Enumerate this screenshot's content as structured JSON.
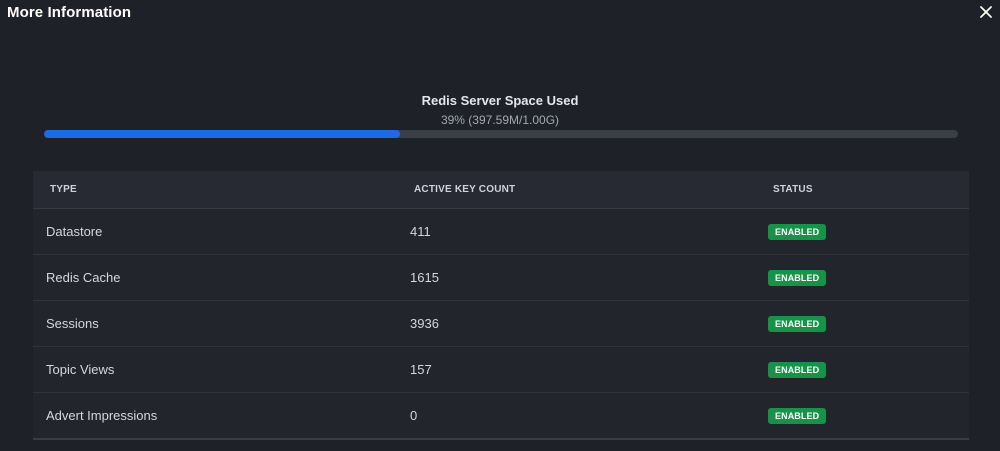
{
  "dialog": {
    "title": "More Information",
    "close_icon": "close-icon"
  },
  "usage": {
    "title": "Redis Server Space Used",
    "summary": "39% (397.59M/1.00G)",
    "percent": 39,
    "accent_color": "#1d6be2"
  },
  "table": {
    "headers": {
      "type": "TYPE",
      "count": "ACTIVE KEY COUNT",
      "status": "STATUS"
    },
    "rows": [
      {
        "type": "Datastore",
        "count": "411",
        "status": "ENABLED"
      },
      {
        "type": "Redis Cache",
        "count": "1615",
        "status": "ENABLED"
      },
      {
        "type": "Sessions",
        "count": "3936",
        "status": "ENABLED"
      },
      {
        "type": "Topic Views",
        "count": "157",
        "status": "ENABLED"
      },
      {
        "type": "Advert Impressions",
        "count": "0",
        "status": "ENABLED"
      }
    ],
    "status_color": "#179349"
  }
}
